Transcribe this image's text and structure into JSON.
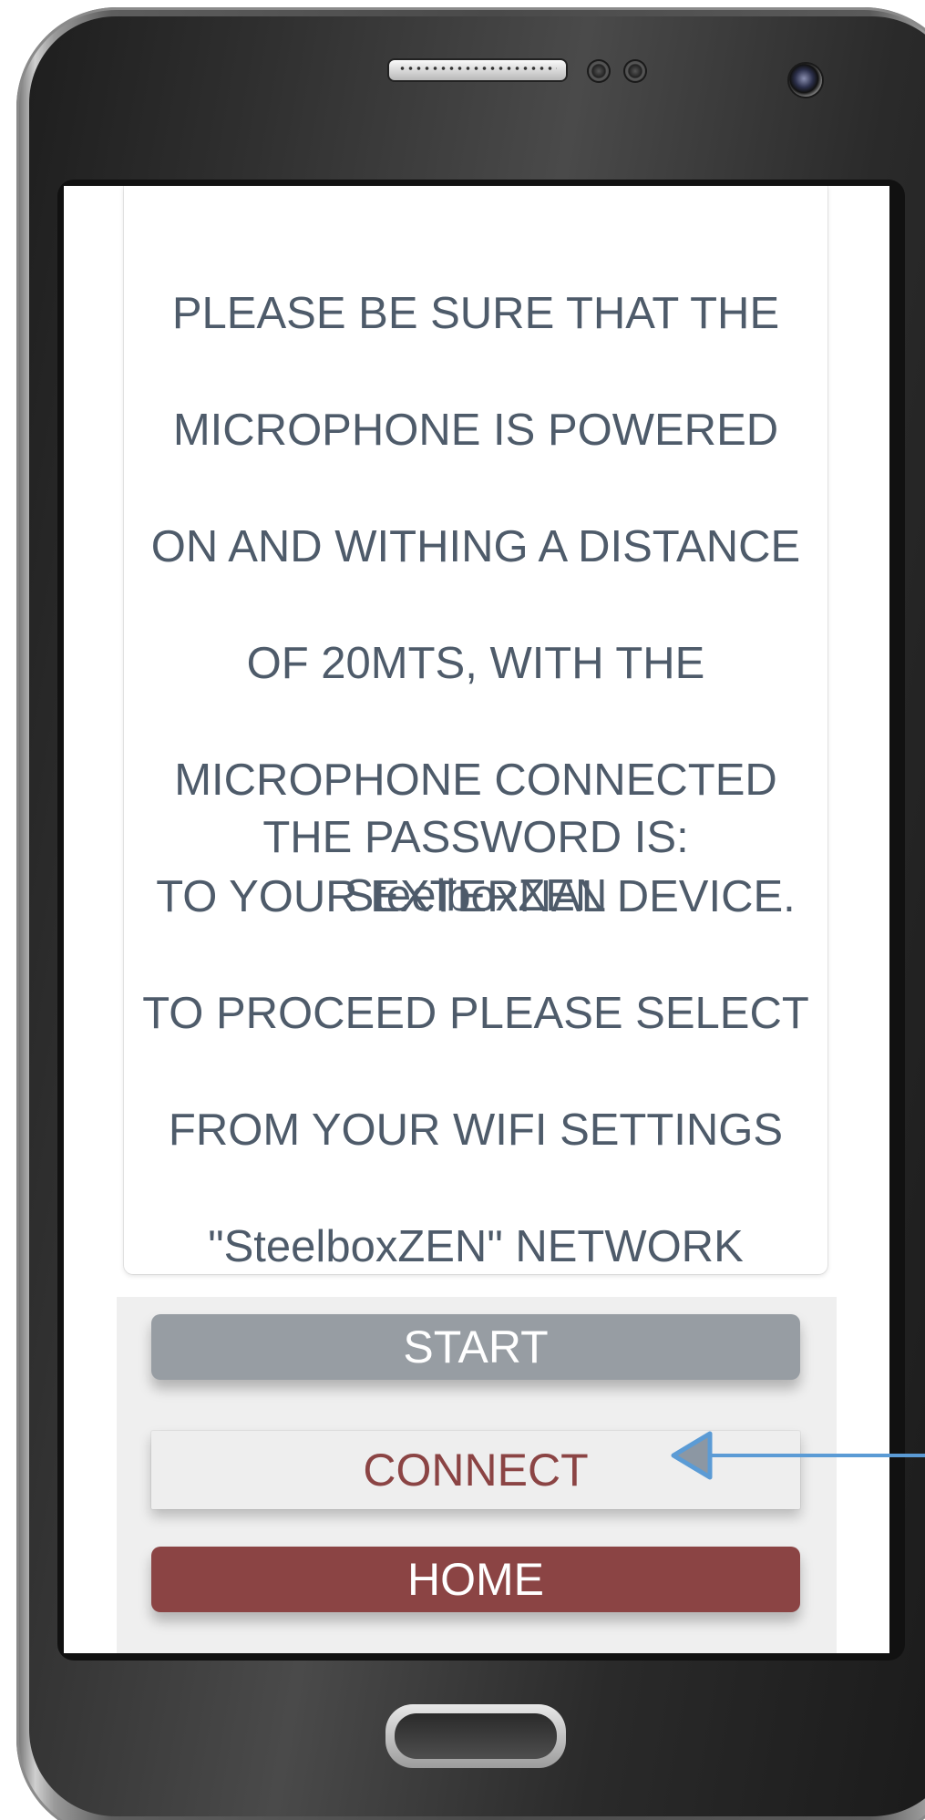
{
  "instructions": {
    "lines": [
      "PLEASE BE SURE THAT THE",
      "MICROPHONE IS POWERED",
      "ON AND WITHING A DISTANCE",
      "OF 20MTS, WITH THE",
      "MICROPHONE CONNECTED",
      "TO YOUR EXTERNAL DEVICE.",
      "TO PROCEED PLEASE SELECT",
      "FROM YOUR WIFI SETTINGS",
      "\"SteelboxZEN\" NETWORK"
    ],
    "password_label": "THE PASSWORD IS:",
    "password_value": "SteelboxZEN"
  },
  "buttons": {
    "start": "START",
    "connect": "CONNECT",
    "home": "HOME"
  },
  "colors": {
    "text": "#4e5b6a",
    "start_bg": "#979da3",
    "connect_text": "#8b4444",
    "home_bg": "#8b4444",
    "arrow": "#5b9bd5"
  },
  "icons": {
    "pointer": "arrow-left-icon"
  }
}
